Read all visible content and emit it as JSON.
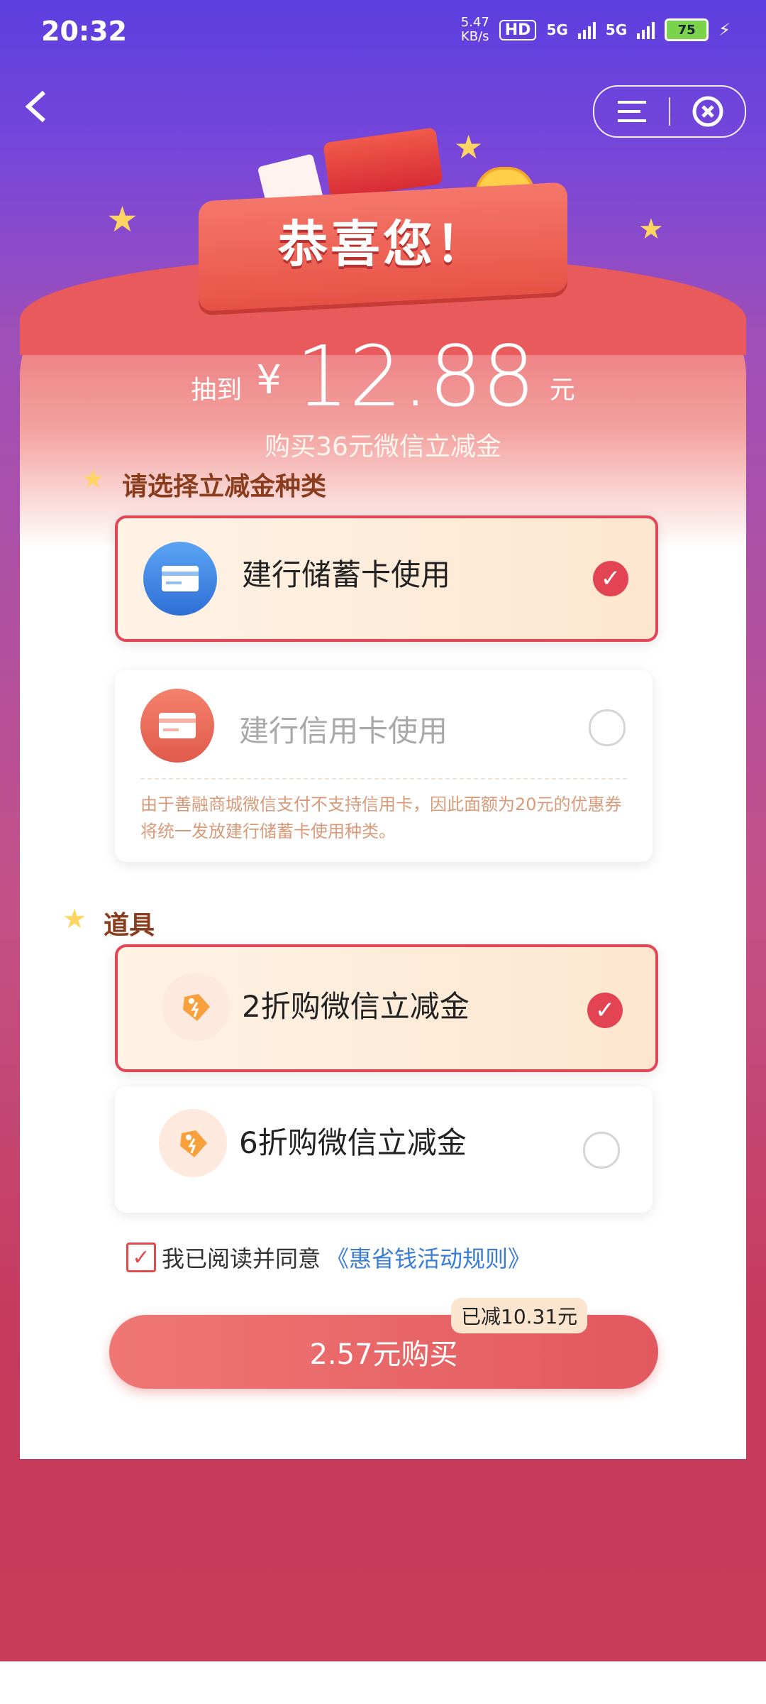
{
  "status_bar": {
    "time": "20:32",
    "net_speed_value": "5.47",
    "net_speed_unit": "KB/s",
    "hd": "HD",
    "sim1": "5G",
    "sim2": "5G",
    "battery": "75"
  },
  "header": {
    "banner_text": "恭喜您！"
  },
  "prize": {
    "label": "抽到",
    "currency": "¥",
    "amount": "12.88",
    "unit": "元",
    "subtitle": "购买36元微信立减金"
  },
  "card_type": {
    "title": "请选择立减金种类",
    "options": [
      {
        "label": "建行储蓄卡使用",
        "selected": true
      },
      {
        "label": "建行信用卡使用",
        "selected": false
      }
    ],
    "note": "由于善融商城微信支付不支持信用卡，因此面额为20元的优惠券将统一发放建行储蓄卡使用种类。"
  },
  "props": {
    "title": "道具",
    "options": [
      {
        "label": "2折购微信立减金",
        "selected": true
      },
      {
        "label": "6折购微信立减金",
        "selected": false
      }
    ]
  },
  "agreement": {
    "checked": true,
    "text": "我已阅读并同意",
    "link": "《惠省钱活动规则》"
  },
  "purchase": {
    "button_label": "2.57元购买",
    "discount_badge": "已减10.31元"
  },
  "colors": {
    "accent": "#e34656",
    "link": "#3a7bd5",
    "bg_top": "#5b3fe0",
    "bg_bottom": "#c83c58"
  }
}
